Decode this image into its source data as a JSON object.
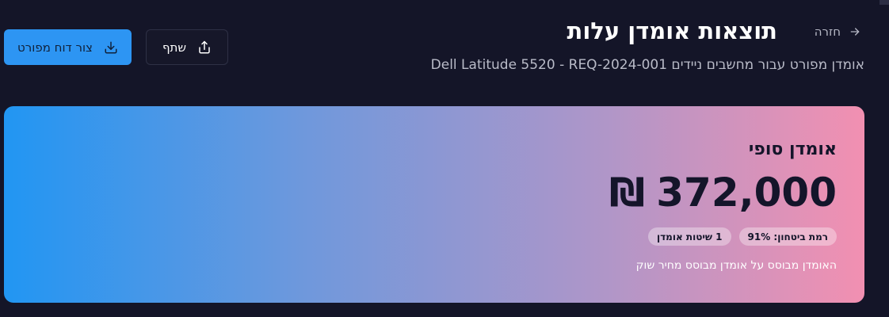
{
  "header": {
    "back_label": "חזרה",
    "title": "תוצאות אומדן עלות",
    "subtitle": "אומדן מפורט עבור מחשבים ניידים Dell Latitude 5520 - REQ-2024-001"
  },
  "actions": {
    "share_label": "שתף",
    "report_label": "צור דוח מפורט"
  },
  "estimate": {
    "label": "אומדן סופי",
    "amount": "372,000",
    "currency": "₪",
    "confidence": "רמת ביטחון: 91%",
    "methods": "1 שיטות אומדן",
    "note": "האומדן מבוסס על אומדן מבוסס מחיר שוק"
  },
  "colors": {
    "background": "#141528",
    "primary": "#2d95f3",
    "gradient_start": "#2196f3",
    "gradient_end": "#f290b1"
  },
  "icons": {
    "back": "arrow-right-icon",
    "share": "share-icon",
    "download": "download-icon"
  }
}
